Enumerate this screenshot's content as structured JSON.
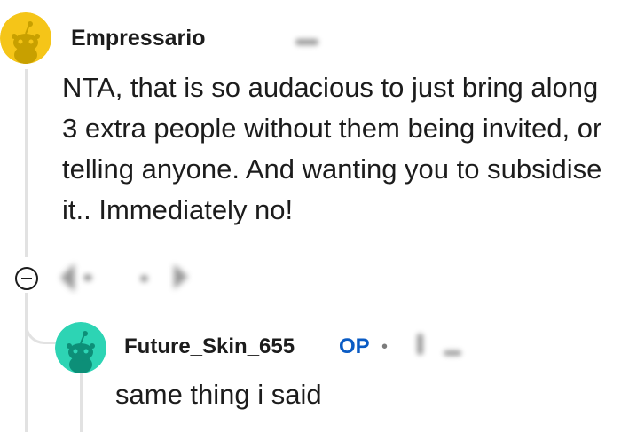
{
  "comment": {
    "author": "Empressario",
    "body": "NTA, that is so audacious to just bring along 3 extra people without them being invited, or telling anyone. And wanting you to subsidise it.. Immediately no!",
    "avatar_color": "#f5c518"
  },
  "reply": {
    "author": "Future_Skin_655",
    "badge": "OP",
    "separator": "•",
    "body": "same thing i said",
    "avatar_color": "#2dd4b4"
  },
  "icons": {
    "collapse": "collapse-minus-icon",
    "upvote": "upvote-arrow-icon",
    "downvote": "downvote-arrow-icon"
  },
  "colors": {
    "op_badge": "#0a5bc4",
    "thread_line": "#e2e2e2"
  }
}
